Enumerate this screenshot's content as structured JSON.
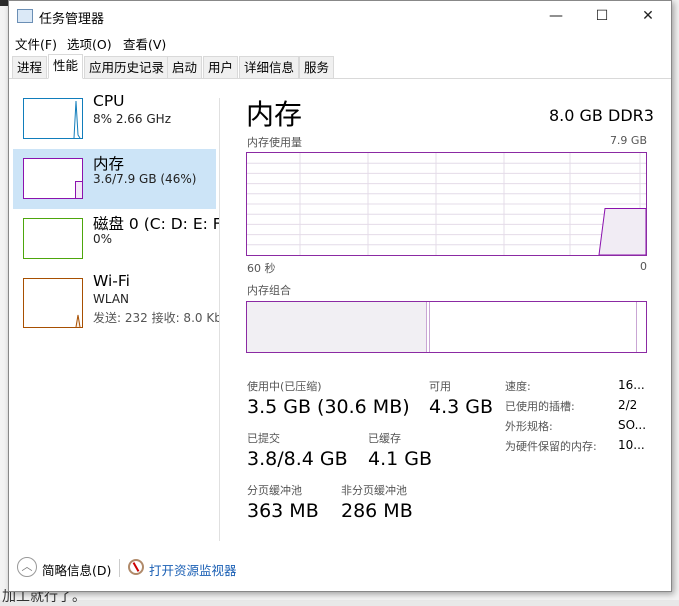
{
  "window": {
    "title": "任务管理器",
    "minimize": "—",
    "maximize": "☐",
    "close": "✕"
  },
  "menu": [
    "文件(F)",
    "选项(O)",
    "查看(V)"
  ],
  "tabs": [
    "进程",
    "性能",
    "应用历史记录",
    "启动",
    "用户",
    "详细信息",
    "服务"
  ],
  "sidebar": [
    {
      "name": "CPU",
      "sub": "8% 2.66 GHz",
      "color": "#117dbb"
    },
    {
      "name": "内存",
      "sub": "3.6/7.9 GB (46%)",
      "color": "#8b12ae"
    },
    {
      "name": "磁盘 0 (C: D: E: F:",
      "sub": "0%",
      "color": "#4da60c"
    },
    {
      "name": "Wi-Fi",
      "sub": "WLAN",
      "sub2": "发送: 232 接收: 8.0 Kb",
      "color": "#a74f01"
    }
  ],
  "main": {
    "title": "内存",
    "spec": "8.0 GB DDR3",
    "usage_label": "内存使用量",
    "usage_max": "7.9 GB",
    "x_left": "60 秒",
    "x_right": "0",
    "composition_label": "内存组合",
    "in_use_label": "使用中(已压缩)",
    "in_use": "3.5 GB (30.6 MB)",
    "available_label": "可用",
    "available": "4.3 GB",
    "committed_label": "已提交",
    "committed": "3.8/8.4 GB",
    "cached_label": "已缓存",
    "cached": "4.1 GB",
    "paged_label": "分页缓冲池",
    "paged": "363 MB",
    "nonpaged_label": "非分页缓冲池",
    "nonpaged": "286 MB",
    "props": [
      {
        "k": "速度:",
        "v": "16..."
      },
      {
        "k": "已使用的插槽:",
        "v": "2/2"
      },
      {
        "k": "外形规格:",
        "v": "SO..."
      },
      {
        "k": "为硬件保留的内存:",
        "v": "10..."
      }
    ]
  },
  "chart_data": {
    "type": "area",
    "title": "内存使用量",
    "ylim": [
      0,
      7.9
    ],
    "xlabel_left": "60 秒",
    "xlabel_right": "0",
    "values_recent_gb": [
      0,
      3.6,
      3.6,
      3.6,
      3.6,
      3.6
    ]
  },
  "footer": {
    "fewer_details": "简略信息(D)",
    "open_monitor": "打开资源监视器"
  },
  "background": {
    "bottom_text": "加工就行了。"
  }
}
